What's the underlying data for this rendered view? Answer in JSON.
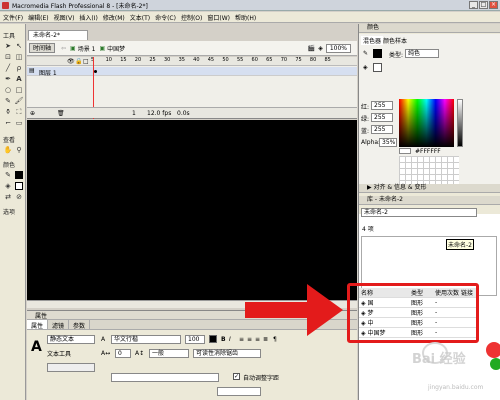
{
  "titlebar": {
    "title": "Macromedia Flash Professional 8 - [未命名-2*]"
  },
  "menu": [
    "文件(F)",
    "编辑(E)",
    "视图(V)",
    "插入(I)",
    "修改(M)",
    "文本(T)",
    "命令(C)",
    "控制(O)",
    "窗口(W)",
    "帮助(H)"
  ],
  "tools": {
    "label": "工具",
    "view_label": "查看",
    "color_label": "颜色",
    "options_label": "选项"
  },
  "document": {
    "tab": "未命名-2*",
    "scene_button": "时间轴",
    "scene_name": "场景 1",
    "object": "中国梦",
    "zoom": "100%"
  },
  "timeline": {
    "layer_name": "图层 1",
    "frames": [
      "5",
      "10",
      "15",
      "20",
      "25",
      "30",
      "35",
      "40",
      "45",
      "50",
      "55",
      "60",
      "65",
      "70",
      "75",
      "80",
      "85"
    ],
    "fps": "12.0 fps",
    "time": "0.0s",
    "frame": "1"
  },
  "properties": {
    "title": "属性",
    "tabs": [
      "属性",
      "滤镜",
      "参数"
    ],
    "text_type": "静态文本",
    "text_tool": "文本工具",
    "font": "华文行楷",
    "size": "100",
    "spacing": "0",
    "baseline": "一般",
    "rendering": "可读性消除锯齿",
    "auto_kern": "自动调整字距"
  },
  "color_panel": {
    "title": "颜色",
    "tab1": "混色器",
    "tab2": "颜色样本",
    "type_label": "类型:",
    "type_value": "纯色",
    "r": "255",
    "g": "255",
    "b": "255",
    "alpha": "35%",
    "hex": "#FFFFFF"
  },
  "panels": {
    "components": "▶ 对齐 & 信息 & 变形",
    "library_title": "库 - 未命名-2",
    "library_select": "未命名-2",
    "items_count": "4 项",
    "tooltip": "未命名-2"
  },
  "library": {
    "headers": [
      "名称",
      "类型",
      "使用次数",
      "链接"
    ],
    "rows": [
      {
        "name": "国",
        "type": "图形",
        "use": "-"
      },
      {
        "name": "梦",
        "type": "图形",
        "use": "-"
      },
      {
        "name": "中",
        "type": "图形",
        "use": "-"
      },
      {
        "name": "中国梦",
        "type": "图形",
        "use": "-"
      }
    ]
  },
  "watermark": {
    "text": "Bai 经验",
    "url": "jingyan.baidu.com"
  },
  "colors": {
    "highlight": "#e31b1b",
    "stage": "#000000",
    "chrome": "#ece9d8"
  }
}
